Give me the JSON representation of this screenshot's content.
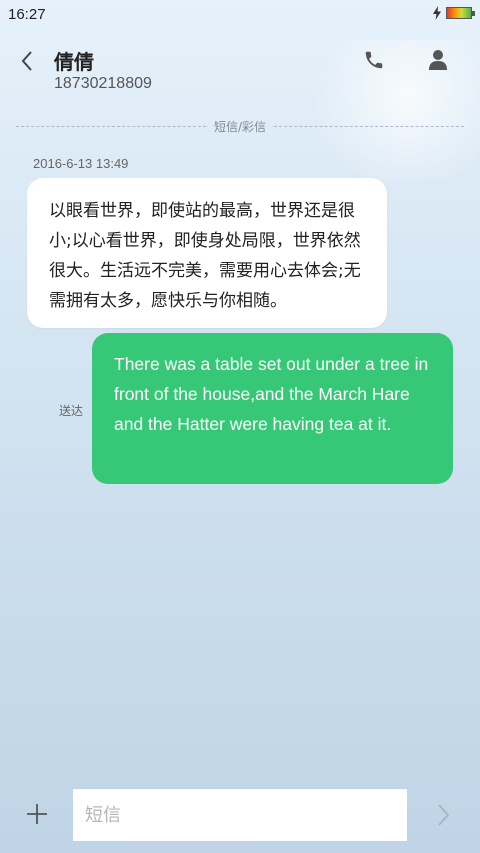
{
  "status_bar": {
    "time": "16:27",
    "icons": [
      "charging-bolt-icon",
      "battery-icon"
    ]
  },
  "header": {
    "contact_name": "倩倩",
    "contact_number": "18730218809",
    "icons": [
      "back-chevron-icon",
      "phone-icon",
      "person-icon"
    ]
  },
  "conversation": {
    "divider_label": "短信/彩信",
    "received": {
      "timestamp": "2016-6-13 13:49",
      "text": "以眼看世界，即使站的最高，世界还是很小;以心看世界，即使身处局限，世界依然很大。生活远不完美，需要用心去体会;无需拥有太多，愿快乐与你相随。"
    },
    "sent": {
      "status": "送达",
      "text": "There was a table set out under a tree in front of the house,and the March Hare and the Hatter were having tea at it."
    }
  },
  "composer": {
    "placeholder": "短信",
    "value": "",
    "icons": [
      "plus-icon",
      "send-chevron-icon"
    ]
  },
  "colors": {
    "sent_bubble": "#36c777",
    "received_bubble": "#ffffff"
  }
}
